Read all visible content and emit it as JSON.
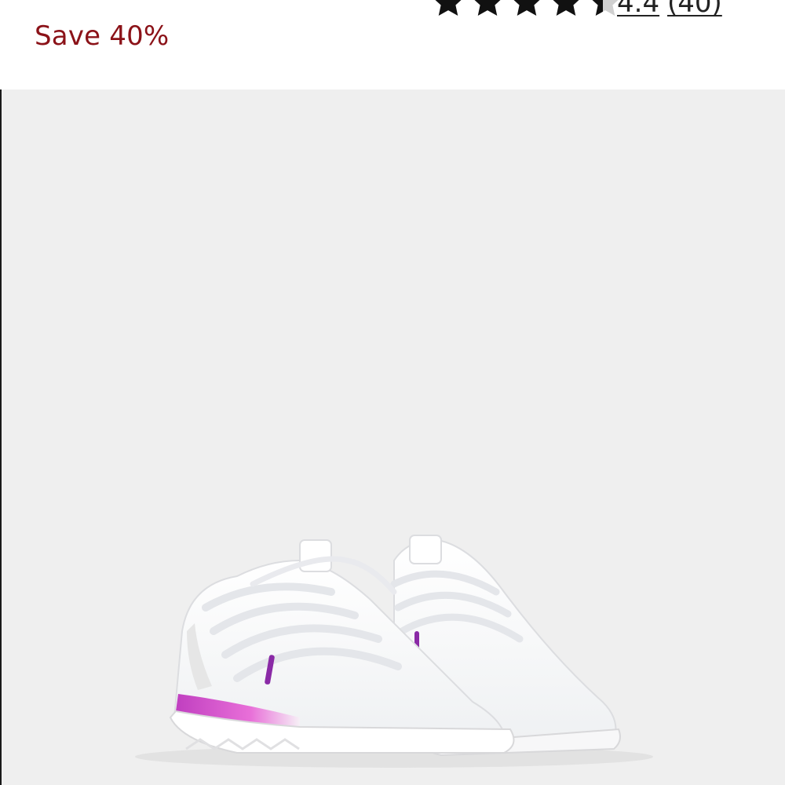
{
  "product": {
    "discount_label": "Save 40%",
    "rating": {
      "value_label": "4.4",
      "review_count_label": "(40)",
      "stars_filled": 4.4,
      "stars_total": 5
    },
    "image": {
      "icon": "sneaker-pair-image"
    }
  },
  "colors": {
    "sale_text": "#8b1218",
    "star_fill": "#111111",
    "star_empty": "#d0d0d0",
    "image_background": "#efefef",
    "accent_pink": "#d24fc5",
    "accent_purple": "#8a2aa6"
  }
}
